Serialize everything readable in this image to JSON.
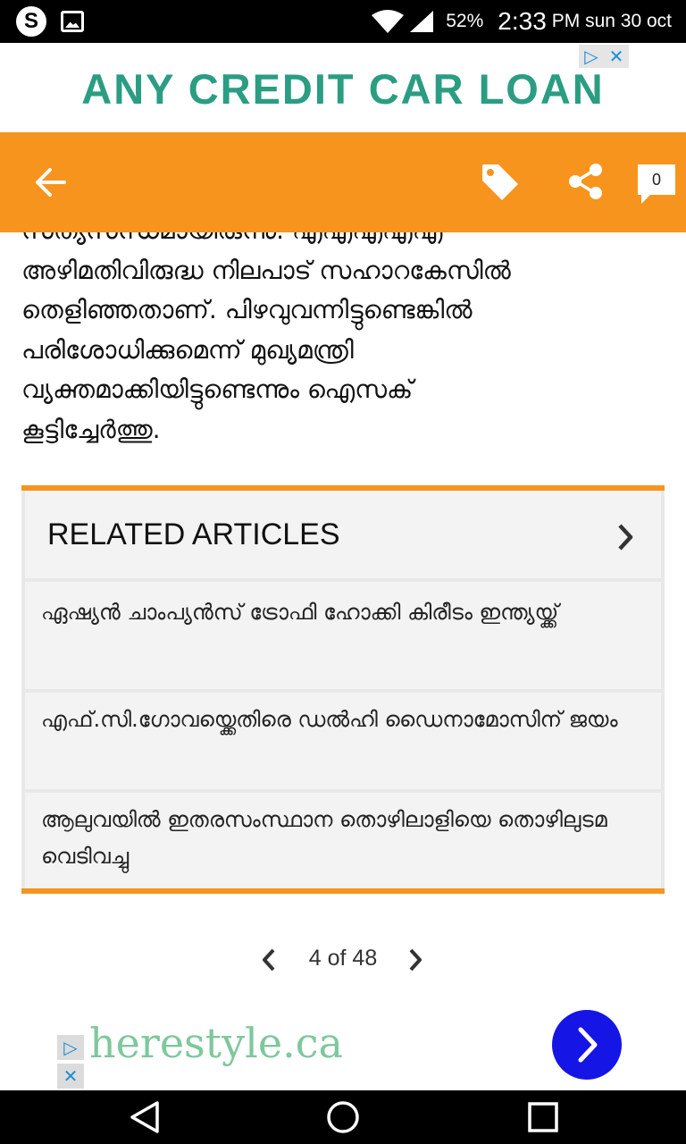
{
  "status_bar": {
    "battery": "52%",
    "time": "2:33",
    "ampm_date": "PM sun 30 oct",
    "skype_letter": "S"
  },
  "ad_top": {
    "text": "ANY CREDIT CAR LOAN",
    "adchoices_glyph": "▷",
    "close_glyph": "✕"
  },
  "app_bar": {
    "comment_count": "0",
    "icons": [
      "back-arrow-icon",
      "tag-icon",
      "share-icon",
      "comment-icon"
    ]
  },
  "article": {
    "body": "സത്യസന്ധമായിരുന്നു. എഎഎഎഎ\nഅഴിമതിവിരുദ്ധ നിലപാട് സഹാറകേസിൽ\nതെളിഞ്ഞതാണ്. പിഴവുവന്നിട്ടുണ്ടെങ്കിൽ\nപരിശോധിക്കുമെന്ന് മുഖ്യമന്ത്രി\nവ്യക്തമാക്കിയിട്ടുണ്ടെന്നും ഐസക്\nകൂട്ടിച്ചേർത്തു."
  },
  "related": {
    "title": "RELATED ARTICLES",
    "items": [
      "ഏഷ്യൻ ചാംപ്യൻസ് ട്രോഫി ഹോക്കി കിരീടം ഇന്ത്യയ്ക്ക്",
      "എഫ്.സി.ഗോവയ്ക്കെതിരെ ഡൽഹി ഡൈനാമോസിന് ജയം",
      " ആലുവയിൽ ഇതരസംസ്ഥാന തൊഴിലാളിയെ തൊഴിലുടമ വെടിവച്ചു"
    ]
  },
  "pager": {
    "text": "4 of 48"
  },
  "ad_bottom": {
    "text": "herestyle.ca",
    "adchoices_glyph": "▷",
    "close_glyph": "✕"
  },
  "colors": {
    "accent": "#f7941d",
    "ad_green": "#2a9d82",
    "ad_blue": "#1515e6"
  }
}
